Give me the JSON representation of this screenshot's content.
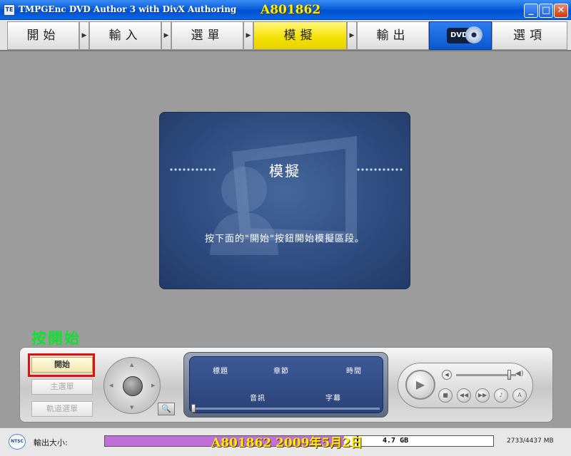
{
  "window": {
    "title": "TMPGEnc DVD Author 3 with DivX Authoring",
    "watermark": "A801862",
    "minimize_glyph": "_",
    "maximize_glyph": "□",
    "close_glyph": "✕",
    "app_icon": "TE"
  },
  "tabs": [
    {
      "label": "開始",
      "active": false
    },
    {
      "label": "輸入",
      "active": false
    },
    {
      "label": "選單",
      "active": false
    },
    {
      "label": "模擬",
      "active": true
    },
    {
      "label": "輸出",
      "active": false
    },
    {
      "label": "選項",
      "active": false
    }
  ],
  "tab_arrow_glyph": "▶",
  "dvd_logo_label": "DVD",
  "preview": {
    "title": "模擬",
    "message": "按下面的\"開始\"按鈕開始模擬區段。"
  },
  "annotation": "按開始",
  "controls": {
    "start_label": "開始",
    "main_menu_label": "主選單",
    "quick_menu_label": "軌道選單",
    "zoom_glyph": "🔍",
    "dpad_up": "▲",
    "dpad_down": "▼",
    "dpad_left": "◀",
    "dpad_right": "▶"
  },
  "info": {
    "title_label": "標題",
    "chapter_label": "章節",
    "time_label": "時間",
    "audio_label": "音訊",
    "subtitle_label": "字幕",
    "seek_position": 0.0
  },
  "player": {
    "play_glyph": "▶",
    "stop_glyph": "■",
    "rewind_glyph": "◀◀",
    "forward_glyph": "▶▶",
    "audio_glyph": "♪",
    "angle_glyph": "A",
    "volume_level": 0.88,
    "volume_low_glyph": "◀",
    "volume_high_glyph": "◀)"
  },
  "status": {
    "ntsc_label": "NTSC",
    "size_label": "輸出大小:",
    "disc_capacity": "4.7 GB",
    "watermark": "A801862  2009年5月2日",
    "size_readout": "2733/4437 MB",
    "used_fraction": 0.616,
    "fill_color": "#c070d8"
  }
}
